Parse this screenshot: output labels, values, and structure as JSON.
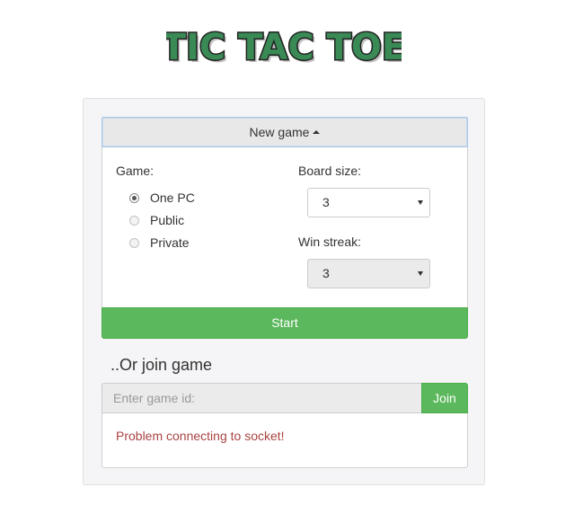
{
  "logo": {
    "text": "TIC TAC TOE",
    "colors": {
      "fill": "#3a8a56",
      "outline": "#222222"
    }
  },
  "new_game": {
    "toggle_label": "New game",
    "toggle_icon": "caret-up-icon"
  },
  "game": {
    "label": "Game:",
    "options": [
      {
        "label": "One PC",
        "checked": true
      },
      {
        "label": "Public",
        "checked": false
      },
      {
        "label": "Private",
        "checked": false
      }
    ]
  },
  "board_size": {
    "label": "Board size:",
    "value": "3"
  },
  "win_streak": {
    "label": "Win streak:",
    "value": "3",
    "disabled": true
  },
  "start_label": "Start",
  "join": {
    "title": "..Or join game",
    "placeholder": "Enter game id:",
    "button_label": "Join"
  },
  "error_message": "Problem connecting to socket!",
  "colors": {
    "success": "#5cb85c",
    "error": "#a94442",
    "panel_bg": "#f5f5f7"
  }
}
